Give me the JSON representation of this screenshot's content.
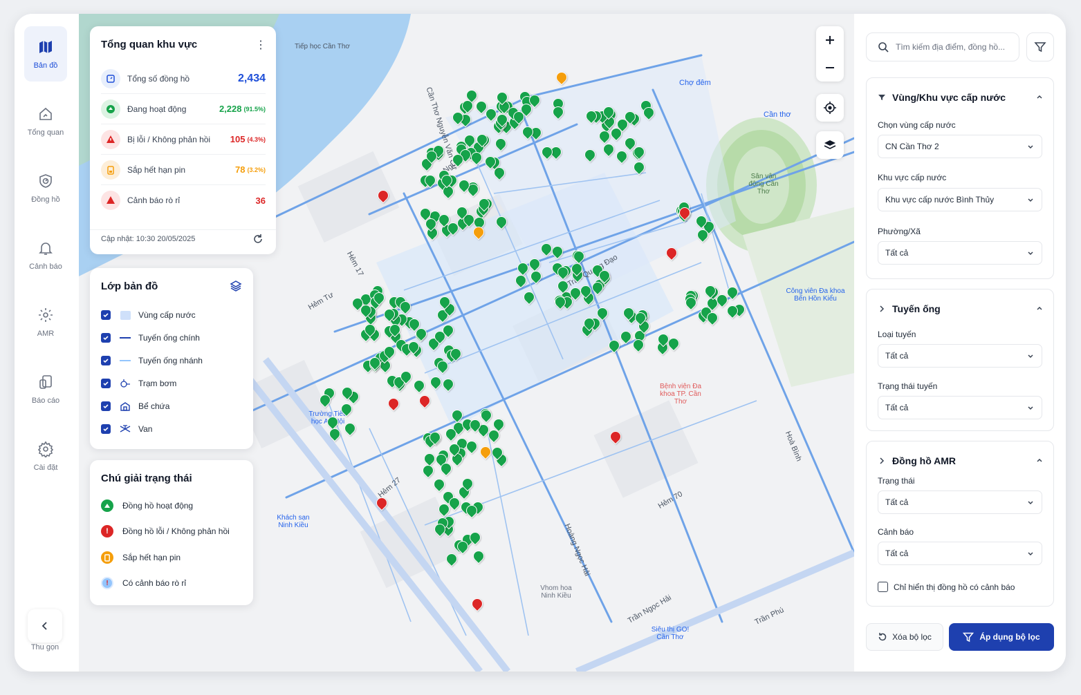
{
  "sidebar": {
    "items": [
      {
        "label": "Bản đồ",
        "icon": "map-icon"
      },
      {
        "label": "Tổng quan",
        "icon": "dashboard-icon"
      },
      {
        "label": "Đồng hồ",
        "icon": "meter-icon"
      },
      {
        "label": "Cảnh báo",
        "icon": "bell-icon"
      },
      {
        "label": "AMR",
        "icon": "gear-icon"
      },
      {
        "label": "Báo cáo",
        "icon": "report-icon"
      },
      {
        "label": "Cài đặt",
        "icon": "settings-icon"
      }
    ],
    "collapse_label": "Thu gọn"
  },
  "overview": {
    "title": "Tổng quan khu vực",
    "rows": [
      {
        "name": "Tổng số đồng hồ",
        "value": "2,434",
        "pct": "",
        "color": "#1d4ed8"
      },
      {
        "name": "Đang hoạt động",
        "value": "2,228",
        "pct": "(91.5%)",
        "color": "#16a34a"
      },
      {
        "name": "Bị lỗi / Không phản hồi",
        "value": "105",
        "pct": "(4.3%)",
        "color": "#dc2626"
      },
      {
        "name": "Sắp hết hạn pin",
        "value": "78",
        "pct": "(3.2%)",
        "color": "#f59e0b"
      },
      {
        "name": "Cảnh báo rò rỉ",
        "value": "36",
        "pct": "",
        "color": "#dc2626"
      }
    ],
    "updated": "Cập nhật: 10:30 20/05/2025"
  },
  "layers": {
    "title": "Lớp bản đồ",
    "items": [
      {
        "label": "Vùng cấp nước"
      },
      {
        "label": "Tuyến ống chính"
      },
      {
        "label": "Tuyến ống nhánh"
      },
      {
        "label": "Trạm bơm"
      },
      {
        "label": "Bể chứa"
      },
      {
        "label": "Van"
      }
    ]
  },
  "legend": {
    "title": "Chú giải trạng thái",
    "items": [
      {
        "label": "Đồng hồ hoạt động",
        "color": "#16a34a"
      },
      {
        "label": "Đồng hồ lỗi / Không phản hồi",
        "color": "#dc2626"
      },
      {
        "label": "Sắp hết hạn pin",
        "color": "#f59e0b"
      },
      {
        "label": "Có cảnh báo rò rỉ",
        "color": "#93c5fd"
      }
    ]
  },
  "map_labels": {
    "cho_dem": "Chợ đêm",
    "can_tho": "Cần thơ",
    "san_van_dong": "Sân vận động Cần Thơ",
    "cong_vien": "Công viên Đa khoa Bến Hồn Kiểu",
    "tiep_hoc": "Tiếp học Cần Thơ",
    "truong": "Trường Tiểu học An Hội",
    "khach_san": "Khách sạn Ninh Kiều",
    "nhom_hoa": "Vhom hoa Ninh Kiều",
    "benh_vien": "Bệnh viện Đa khoa TP. Cần Thơ",
    "sieu_thi": "Siêu thị GO! Cần Thơ",
    "street_1": "Cần Thơ Nguyễn Văn Cừ",
    "street_2": "Nguyễn Văn Cừ",
    "street_3": "Trần Quang Đạo",
    "street_4": "Hẻm 17",
    "street_5": "Hẻm Tư",
    "street_6": "Hẻm 27",
    "street_7": "Hẻm 70",
    "street_8": "Hoàng Ngọc Hải",
    "street_9": "Trần Ngọc Hải",
    "street_10": "Trần Phú",
    "street_11": "Hoà Bình"
  },
  "panel": {
    "search_placeholder": "Tìm kiếm địa điểm, đồng hồ...",
    "section1": {
      "title": "Vùng/Khu vực cấp nước",
      "f1_label": "Chọn vùng cấp nước",
      "f1_value": "CN Cần Thơ 2",
      "f2_label": "Khu vực cấp nước",
      "f2_value": "Khu vực cấp nước Bình Thủy",
      "f3_label": "Phường/Xã",
      "f3_value": "Tất cả"
    },
    "section2": {
      "title": "Tuyến ống",
      "f1_label": "Loại tuyến",
      "f1_value": "Tất cả",
      "f2_label": "Trạng thái tuyến",
      "f2_value": "Tất cả"
    },
    "section3": {
      "title": "Đồng hồ AMR",
      "f1_label": "Trạng thái",
      "f1_value": "Tất cả",
      "f2_label": "Cảnh báo",
      "f2_value": "Tất cả",
      "checkbox_label": "Chỉ hiển thị đồng hồ có cảnh báo"
    },
    "clear_label": "Xóa bộ lọc",
    "apply_label": "Áp dụng bộ lọc"
  }
}
